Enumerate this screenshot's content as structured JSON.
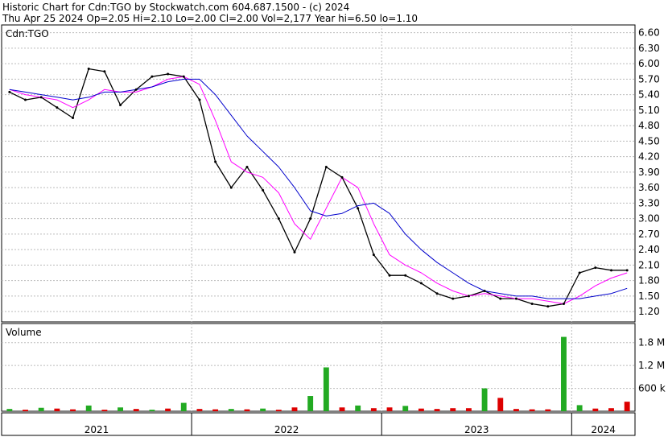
{
  "header": {
    "line1": "Historic Chart for Cdn:TGO by Stockwatch.com 604.687.1500 - (c) 2024",
    "line2": "Thu Apr 25 2024  Op=2.05  Hi=2.10  Lo=2.00  Cl=2.00  Vol=2,177  Year hi=6.50  lo=1.10"
  },
  "colors": {
    "price": "#000000",
    "ma_short": "#ff00ff",
    "ma_long": "#0000cc",
    "volume_up": "#22aa22",
    "volume_down": "#dd0000",
    "grid": "#bbbbbb"
  },
  "chart_data": [
    {
      "type": "line",
      "title": "Cdn:TGO",
      "ylim": [
        1.0,
        6.75
      ],
      "y_ticks": [
        "6.60",
        "6.30",
        "6.00",
        "5.70",
        "5.40",
        "5.10",
        "4.80",
        "4.50",
        "4.20",
        "3.90",
        "3.60",
        "3.30",
        "3.00",
        "2.70",
        "2.40",
        "2.10",
        "1.80",
        "1.50",
        "1.20"
      ],
      "x_ticks": [
        "2021",
        "2022",
        "2023",
        "2024"
      ],
      "x": [
        "2021-01",
        "2021-02",
        "2021-03",
        "2021-04",
        "2021-05",
        "2021-06",
        "2021-07",
        "2021-08",
        "2021-09",
        "2021-10",
        "2021-11",
        "2021-12",
        "2022-01",
        "2022-02",
        "2022-03",
        "2022-04",
        "2022-05",
        "2022-06",
        "2022-07",
        "2022-08",
        "2022-09",
        "2022-10",
        "2022-11",
        "2022-12",
        "2023-01",
        "2023-02",
        "2023-03",
        "2023-04",
        "2023-05",
        "2023-06",
        "2023-07",
        "2023-08",
        "2023-09",
        "2023-10",
        "2023-11",
        "2023-12",
        "2024-01",
        "2024-02",
        "2024-03",
        "2024-04"
      ],
      "series": [
        {
          "values": [
            5.45,
            5.3,
            5.35,
            5.15,
            4.95,
            5.9,
            5.85,
            5.2,
            5.5,
            5.75,
            5.8,
            5.75,
            5.3,
            4.1,
            3.6,
            4.0,
            3.55,
            3.0,
            2.35,
            3.0,
            4.0,
            3.8,
            3.2,
            2.3,
            1.9,
            1.9,
            1.75,
            1.55,
            1.45,
            1.5,
            1.6,
            1.45,
            1.45,
            1.35,
            1.3,
            1.35,
            1.95,
            2.05,
            2.0,
            2.0
          ]
        },
        {
          "values": [
            5.5,
            5.4,
            5.35,
            5.3,
            5.15,
            5.3,
            5.5,
            5.45,
            5.45,
            5.55,
            5.7,
            5.75,
            5.6,
            4.9,
            4.1,
            3.9,
            3.8,
            3.5,
            2.9,
            2.6,
            3.2,
            3.8,
            3.6,
            2.9,
            2.3,
            2.1,
            1.95,
            1.75,
            1.6,
            1.5,
            1.55,
            1.5,
            1.45,
            1.45,
            1.4,
            1.35,
            1.5,
            1.7,
            1.85,
            1.95
          ]
        },
        {
          "values": [
            5.5,
            5.45,
            5.4,
            5.35,
            5.3,
            5.35,
            5.45,
            5.45,
            5.5,
            5.55,
            5.65,
            5.7,
            5.7,
            5.4,
            5.0,
            4.6,
            4.3,
            4.0,
            3.6,
            3.15,
            3.05,
            3.1,
            3.25,
            3.3,
            3.1,
            2.7,
            2.4,
            2.15,
            1.95,
            1.75,
            1.6,
            1.55,
            1.5,
            1.5,
            1.45,
            1.45,
            1.45,
            1.5,
            1.55,
            1.65
          ]
        }
      ]
    },
    {
      "type": "bar",
      "title": "Volume",
      "y_ticks": [
        "1.8 M",
        "1.2 M",
        "600 k"
      ],
      "ylim": [
        0,
        2300000
      ],
      "x": [
        "2021-01",
        "2021-02",
        "2021-03",
        "2021-04",
        "2021-05",
        "2021-06",
        "2021-07",
        "2021-08",
        "2021-09",
        "2021-10",
        "2021-11",
        "2021-12",
        "2022-01",
        "2022-02",
        "2022-03",
        "2022-04",
        "2022-05",
        "2022-06",
        "2022-07",
        "2022-08",
        "2022-09",
        "2022-10",
        "2022-11",
        "2022-12",
        "2023-01",
        "2023-02",
        "2023-03",
        "2023-04",
        "2023-05",
        "2023-06",
        "2023-07",
        "2023-08",
        "2023-09",
        "2023-10",
        "2023-11",
        "2023-12",
        "2024-01",
        "2024-02",
        "2024-03",
        "2024-04"
      ],
      "values": [
        60000,
        40000,
        90000,
        70000,
        50000,
        150000,
        40000,
        100000,
        60000,
        40000,
        70000,
        220000,
        60000,
        50000,
        60000,
        50000,
        70000,
        40000,
        100000,
        400000,
        1150000,
        100000,
        150000,
        80000,
        100000,
        140000,
        70000,
        60000,
        80000,
        80000,
        600000,
        350000,
        60000,
        50000,
        50000,
        1950000,
        160000,
        70000,
        80000,
        250000
      ],
      "direction": [
        "up",
        "down",
        "up",
        "down",
        "down",
        "up",
        "down",
        "up",
        "down",
        "up",
        "down",
        "up",
        "down",
        "down",
        "up",
        "down",
        "up",
        "down",
        "down",
        "up",
        "up",
        "down",
        "up",
        "down",
        "down",
        "up",
        "down",
        "down",
        "down",
        "down",
        "up",
        "down",
        "down",
        "down",
        "down",
        "up",
        "up",
        "down",
        "down",
        "down"
      ]
    }
  ]
}
